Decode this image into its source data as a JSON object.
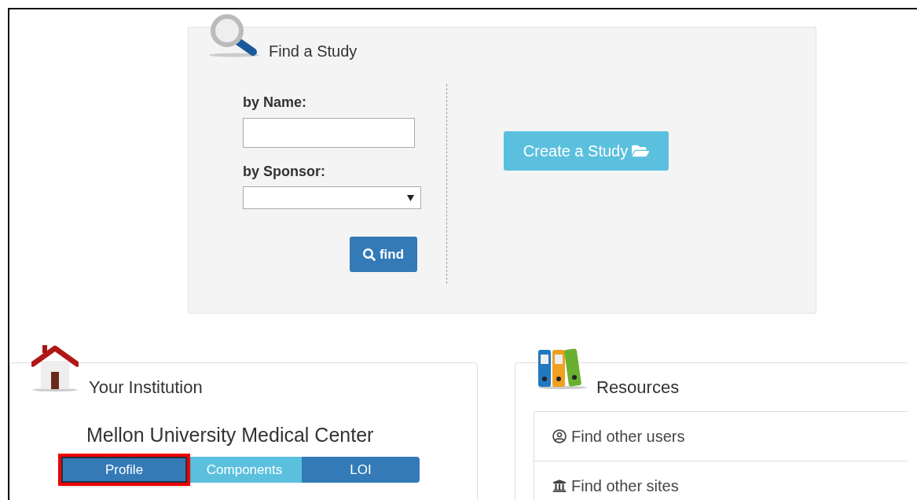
{
  "find_study": {
    "title": "Find a Study",
    "name_label": "by Name:",
    "sponsor_label": "by Sponsor:",
    "find_button": "find",
    "create_button": "Create a Study"
  },
  "institution": {
    "title": "Your Institution",
    "name": "Mellon University Medical Center",
    "buttons": [
      {
        "label": "Profile",
        "kind": "primary",
        "highlighted": true
      },
      {
        "label": "Components",
        "kind": "info",
        "highlighted": false
      },
      {
        "label": "LOI",
        "kind": "primary",
        "highlighted": false
      }
    ]
  },
  "resources": {
    "title": "Resources",
    "items": [
      {
        "label": "Find other users",
        "kind": "users"
      },
      {
        "label": "Find other sites",
        "kind": "sites"
      }
    ]
  }
}
